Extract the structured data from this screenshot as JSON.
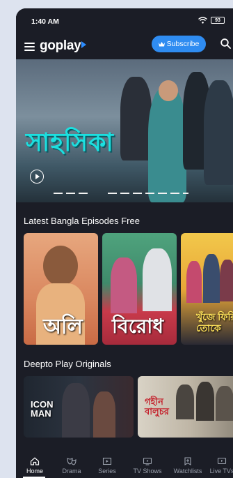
{
  "status_bar": {
    "time": "1:40 AM",
    "battery": "93"
  },
  "app_bar": {
    "logo": "goplay",
    "subscribe_label": "Subscribe"
  },
  "hero": {
    "title": "সাহসিকা"
  },
  "sections": [
    {
      "title": "Latest Bangla Episodes Free",
      "cards": [
        {
          "title": "অলি"
        },
        {
          "title": "বিরোধ"
        },
        {
          "title": "খুঁজে ফিরি তোকে"
        }
      ]
    },
    {
      "title": "Deepto Play Originals",
      "cards": [
        {
          "title": "ICON MAN"
        },
        {
          "title": "গহীন বালুচর"
        }
      ]
    }
  ],
  "bottom_nav": {
    "items": [
      {
        "label": "Home",
        "icon": "home-icon",
        "active": true
      },
      {
        "label": "Drama",
        "icon": "drama-icon",
        "active": false
      },
      {
        "label": "Series",
        "icon": "series-icon",
        "active": false
      },
      {
        "label": "TV Shows",
        "icon": "tv-shows-icon",
        "active": false
      },
      {
        "label": "Watchlists",
        "icon": "watchlist-icon",
        "active": false
      },
      {
        "label": "Live TVs",
        "icon": "live-tv-icon",
        "active": false
      }
    ]
  },
  "colors": {
    "background": "#1b1d26",
    "accent": "#2f8cf1",
    "hero_title": "#1ce0e0"
  }
}
